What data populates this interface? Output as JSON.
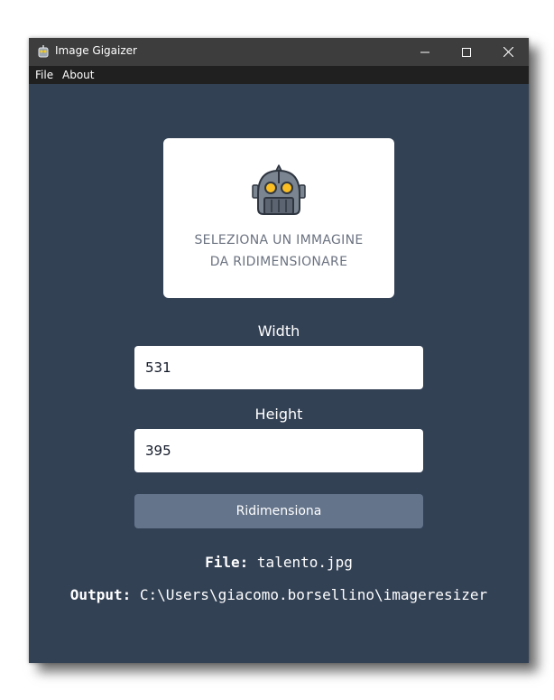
{
  "window": {
    "title": "Image Gigaizer",
    "controls": {
      "minimize_icon": "minimize-icon",
      "maximize_icon": "maximize-icon",
      "close_icon": "close-icon"
    }
  },
  "menu": {
    "items": [
      {
        "label": "File"
      },
      {
        "label": "About"
      }
    ]
  },
  "dropzone": {
    "icon": "robot-icon",
    "line1": "SELEZIONA UN IMMAGINE",
    "line2": "DA RIDIMENSIONARE"
  },
  "form": {
    "width_label": "Width",
    "width_value": "531",
    "height_label": "Height",
    "height_value": "395",
    "submit_label": "Ridimensiona"
  },
  "info": {
    "file_label": "File:",
    "file_value": "talento.jpg",
    "output_label": "Output:",
    "output_value": "C:\\Users\\giacomo.borsellino\\imageresizer"
  },
  "colors": {
    "background": "#334155",
    "titlebar": "#3d3d3d",
    "menubar": "#202020",
    "button": "#64748b",
    "card": "#ffffff"
  }
}
